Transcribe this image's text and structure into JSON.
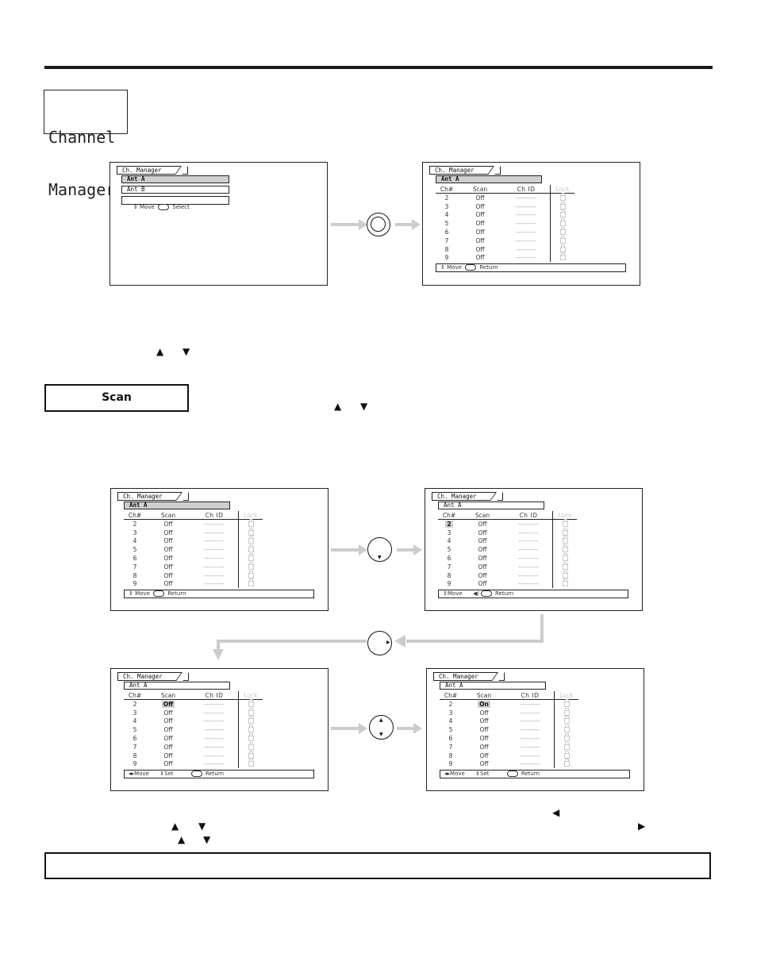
{
  "page": {
    "section_title_line1": "Channel",
    "section_title_line2": "Manager",
    "subsection_label": "Scan"
  },
  "glyphs": {
    "up": "▲",
    "down": "▼",
    "left": "◀",
    "right": "▶"
  },
  "screens": {
    "menu": {
      "tab": "Ch. Manager",
      "items": [
        {
          "label": "Ant A",
          "selected": true
        },
        {
          "label": "Ant B",
          "selected": false
        }
      ],
      "footer_move": "Move",
      "footer_action": "Select"
    },
    "table_headers": {
      "ch": "Ch#",
      "scan": "Scan",
      "id": "Ch ID",
      "lock": "Lock"
    },
    "channel_list": {
      "tab": "Ch. Manager",
      "antenna": "Ant A",
      "rows": [
        {
          "ch": "2",
          "scan": "Off",
          "id": "--------"
        },
        {
          "ch": "3",
          "scan": "Off",
          "id": "--------"
        },
        {
          "ch": "4",
          "scan": "Off",
          "id": "--------"
        },
        {
          "ch": "5",
          "scan": "Off",
          "id": "--------"
        },
        {
          "ch": "6",
          "scan": "Off",
          "id": "--------"
        },
        {
          "ch": "7",
          "scan": "Off",
          "id": "--------"
        },
        {
          "ch": "8",
          "scan": "Off",
          "id": "--------"
        },
        {
          "ch": "9",
          "scan": "Off",
          "id": "--------"
        }
      ],
      "footer_move": "Move",
      "footer_return": "Return"
    },
    "step2_footer": {
      "move": "Move",
      "return": "Return",
      "sep": "◀/"
    },
    "step3_footer": {
      "move": "Move",
      "set": "Set",
      "return": "Return"
    },
    "step4_rows_first_scan": "On"
  }
}
